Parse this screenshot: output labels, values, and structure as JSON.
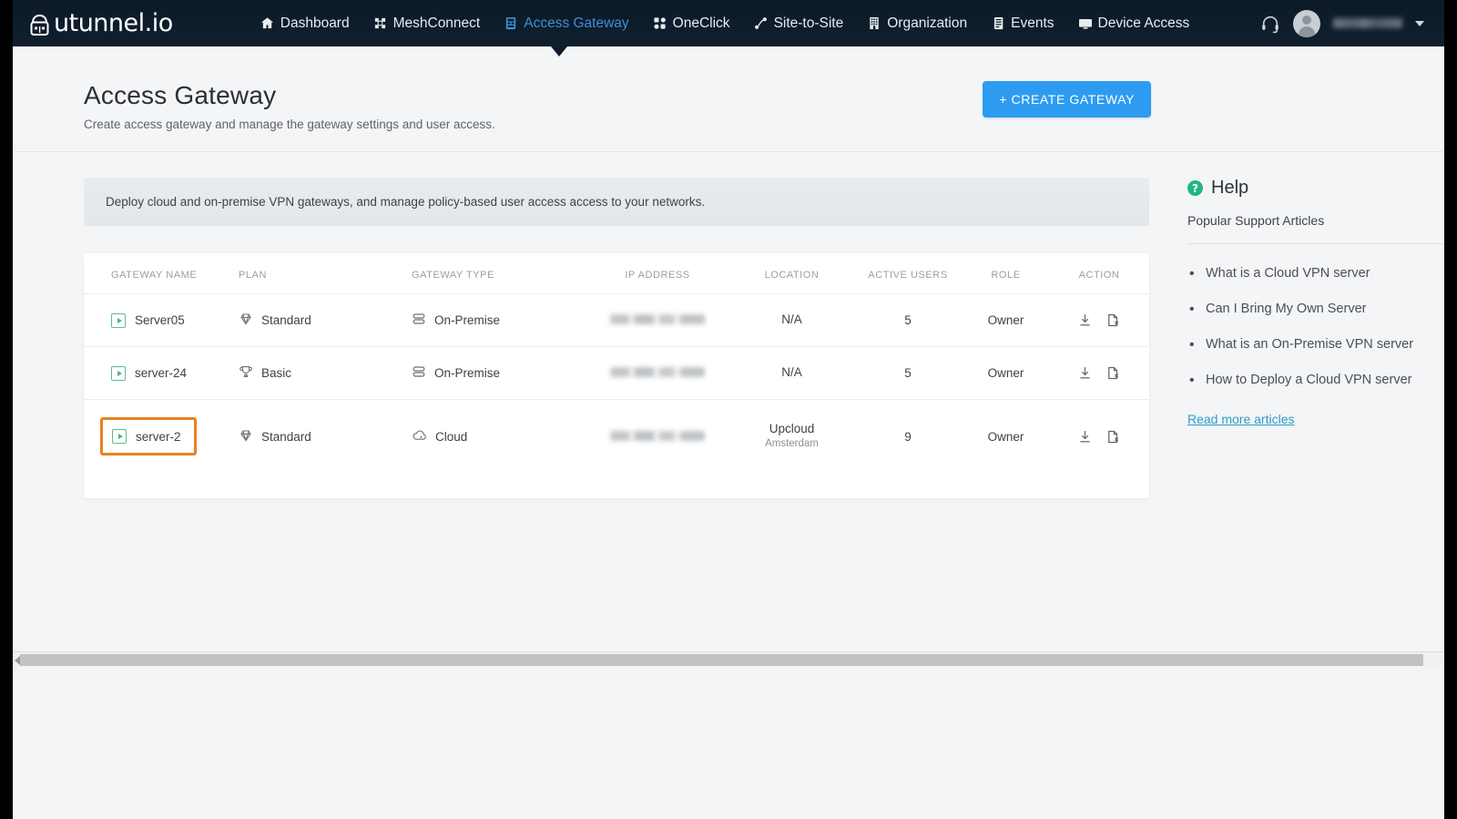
{
  "navbar": {
    "logo_text": "utunnel.io",
    "logo_icon": "lock-tunnel-icon",
    "links": [
      {
        "label": "Dashboard",
        "icon": "home-icon",
        "active": false
      },
      {
        "label": "MeshConnect",
        "icon": "mesh-network-icon",
        "active": false
      },
      {
        "label": "Access Gateway",
        "icon": "gateway-server-icon",
        "active": true
      },
      {
        "label": "OneClick",
        "icon": "grid-squares-icon",
        "active": false
      },
      {
        "label": "Site-to-Site",
        "icon": "link-nodes-icon",
        "active": false
      },
      {
        "label": "Organization",
        "icon": "building-icon",
        "active": false
      },
      {
        "label": "Events",
        "icon": "list-document-icon",
        "active": false
      },
      {
        "label": "Device Access",
        "icon": "monitor-icon",
        "active": false
      }
    ],
    "support_icon": "headset-icon",
    "avatar_icon": "user-avatar",
    "username": "",
    "dropdown_icon": "chevron-down-icon"
  },
  "header": {
    "title": "Access Gateway",
    "subtitle": "Create access gateway and manage the gateway settings and user access.",
    "create_button": "+ CREATE GATEWAY"
  },
  "info_banner": {
    "text": "Deploy cloud and on-premise VPN gateways, and manage policy-based user access access to your networks."
  },
  "table": {
    "columns": [
      "GATEWAY NAME",
      "PLAN",
      "GATEWAY TYPE",
      "IP ADDRESS",
      "LOCATION",
      "ACTIVE USERS",
      "ROLE",
      "ACTION"
    ],
    "rows": [
      {
        "name": "Server05",
        "name_icon": "gateway-status-icon",
        "plan": "Standard",
        "plan_icon": "gem-icon",
        "type": "On-Premise",
        "type_icon": "server-stack-icon",
        "ip": "",
        "ip_masked": true,
        "location": "N/A",
        "location_sub": "",
        "active_users": "5",
        "role": "Owner",
        "actions": [
          "download-icon",
          "file-remove-icon"
        ],
        "highlighted": false
      },
      {
        "name": "server-24",
        "name_icon": "gateway-status-icon",
        "plan": "Basic",
        "plan_icon": "trophy-icon",
        "type": "On-Premise",
        "type_icon": "server-stack-icon",
        "ip": "",
        "ip_masked": true,
        "location": "N/A",
        "location_sub": "",
        "active_users": "5",
        "role": "Owner",
        "actions": [
          "download-icon",
          "file-remove-icon"
        ],
        "highlighted": false
      },
      {
        "name": "server-2",
        "name_icon": "gateway-status-icon",
        "plan": "Standard",
        "plan_icon": "gem-icon",
        "type": "Cloud",
        "type_icon": "cloud-icon",
        "ip": "",
        "ip_masked": true,
        "location": "Upcloud",
        "location_sub": "Amsterdam",
        "active_users": "9",
        "role": "Owner",
        "actions": [
          "download-icon",
          "file-remove-icon"
        ],
        "highlighted": true
      }
    ]
  },
  "help": {
    "title": "Help",
    "icon": "question-circle-icon",
    "subtitle": "Popular Support Articles",
    "articles": [
      "What is a Cloud VPN server",
      "Can I Bring My Own Server",
      "What is an On-Premise VPN server",
      "How to Deploy a Cloud VPN server"
    ],
    "read_more": "Read more articles"
  },
  "colors": {
    "navbar_bg": "#0d1b2a",
    "accent_blue": "#2d9cf0",
    "active_link": "#3d8fd6",
    "highlight_orange": "#e8821e",
    "help_green": "#1eb980",
    "status_green": "#5bbd8e",
    "link_blue": "#2c9bc9",
    "page_bg": "#f4f5f6"
  }
}
